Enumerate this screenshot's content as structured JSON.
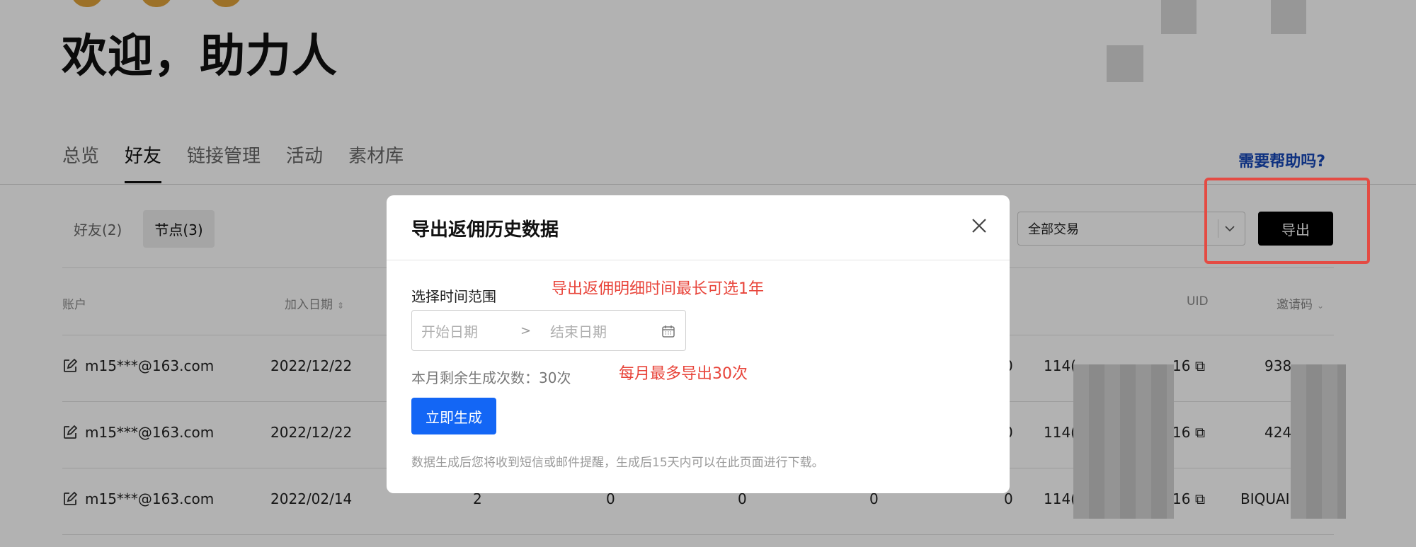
{
  "header": {
    "welcome": "欢迎，助力人",
    "help_link": "需要帮助吗?"
  },
  "tabs": [
    {
      "label": "总览"
    },
    {
      "label": "好友"
    },
    {
      "label": "链接管理"
    },
    {
      "label": "活动"
    },
    {
      "label": "素材库"
    }
  ],
  "subtabs": [
    {
      "label": "好友(2)"
    },
    {
      "label": "节点(3)"
    }
  ],
  "toolbar": {
    "trade_select": "全部交易",
    "export_label": "导出"
  },
  "table": {
    "headers": {
      "account": "账户",
      "join_date": "加入日期",
      "uid": "UID",
      "invite_code": "邀请码"
    },
    "rows": [
      {
        "email": "m15***@163.com",
        "date": "2022/12/22",
        "c1": "",
        "c2": "",
        "c3": "",
        "c4": "",
        "c5": "0",
        "uid_prefix": "114(",
        "uid_suffix": "16",
        "code": "938"
      },
      {
        "email": "m15***@163.com",
        "date": "2022/12/22",
        "c1": "",
        "c2": "",
        "c3": "",
        "c4": "",
        "c5": "0",
        "uid_prefix": "114(",
        "uid_suffix": "16",
        "code": "424"
      },
      {
        "email": "m15***@163.com",
        "date": "2022/02/14",
        "c1": "2",
        "c2": "0",
        "c3": "0",
        "c4": "0",
        "c5": "0",
        "uid_prefix": "114(",
        "uid_suffix": "16",
        "code": "BIQUAI"
      }
    ]
  },
  "modal": {
    "title": "导出返佣历史数据",
    "range_label": "选择时间范围",
    "start_placeholder": "开始日期",
    "separator": ">",
    "end_placeholder": "结束日期",
    "remaining": "本月剩余生成次数：30次",
    "generate_label": "立即生成",
    "note": "数据生成后您将收到短信或邮件提醒，生成后15天内可以在此页面进行下载。"
  },
  "annotations": {
    "range_hint": "导出返佣明细时间最长可选1年",
    "limit_hint": "每月最多导出30次"
  },
  "colors": {
    "primary_blue": "#1366f5",
    "help_link": "#1748b8",
    "annotation_red": "#e8443a",
    "export_black": "#000000"
  }
}
